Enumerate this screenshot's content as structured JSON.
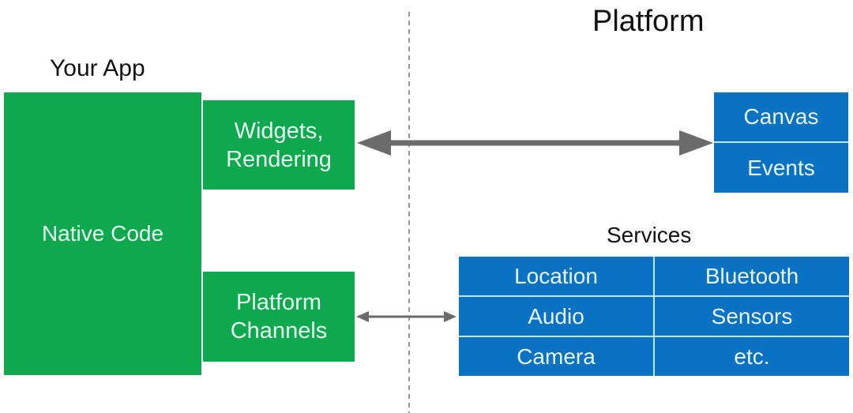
{
  "diagram": {
    "headings": {
      "your_app": "Your App",
      "platform": "Platform",
      "services": "Services"
    },
    "app_blocks": {
      "native_code": "Native Code",
      "widgets_rendering_line1": "Widgets,",
      "widgets_rendering_line2": "Rendering",
      "platform_channels_line1": "Platform",
      "platform_channels_line2": "Channels"
    },
    "platform_blocks": {
      "canvas": "Canvas",
      "events": "Events"
    },
    "services_grid": [
      [
        "Location",
        "Bluetooth"
      ],
      [
        "Audio",
        "Sensors"
      ],
      [
        "Camera",
        "etc."
      ]
    ],
    "colors": {
      "app_green": "#0ea84f",
      "platform_blue": "#0a72c2",
      "arrow_gray": "#6b6b6b",
      "divider_gray": "#777777"
    },
    "connections": [
      {
        "from": "Widgets, Rendering",
        "to": "Canvas / Events",
        "direction": "bidirectional"
      },
      {
        "from": "Platform Channels",
        "to": "Services",
        "direction": "bidirectional"
      }
    ]
  }
}
